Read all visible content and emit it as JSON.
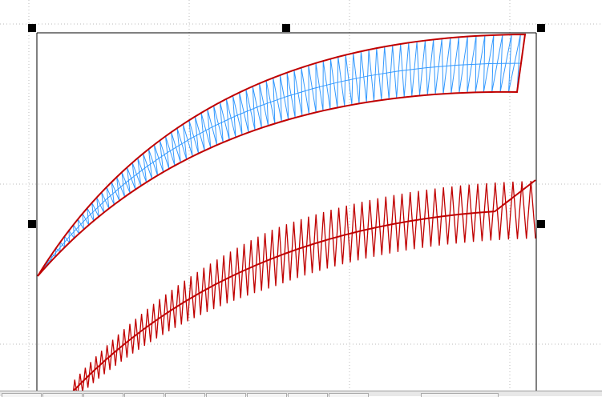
{
  "canvas": {
    "grid_color": "#bbbbbb",
    "stitch_fill_color": "#3399ff",
    "outline_color": "#c00000",
    "running_stitch_color": "#c00000",
    "handle_color": "#000000"
  },
  "bottom_bar": {
    "tab_count": 9
  }
}
